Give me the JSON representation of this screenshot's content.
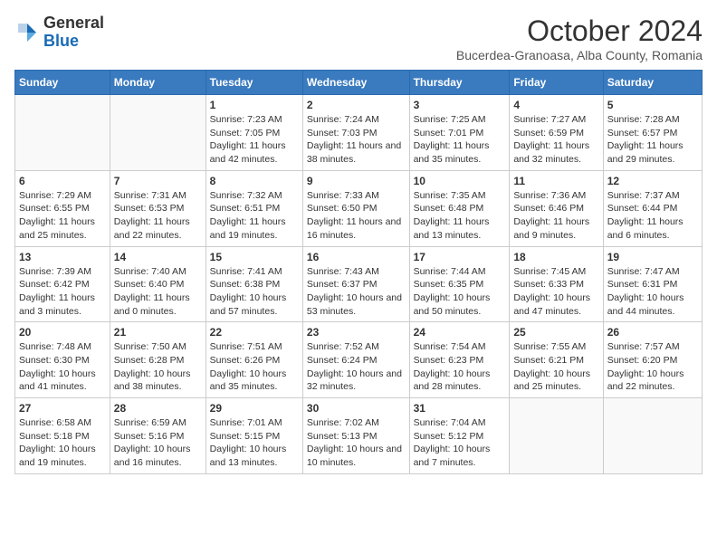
{
  "header": {
    "logo_general": "General",
    "logo_blue": "Blue",
    "month_title": "October 2024",
    "subtitle": "Bucerdea-Granoasa, Alba County, Romania"
  },
  "days_of_week": [
    "Sunday",
    "Monday",
    "Tuesday",
    "Wednesday",
    "Thursday",
    "Friday",
    "Saturday"
  ],
  "weeks": [
    [
      {
        "day": "",
        "info": ""
      },
      {
        "day": "",
        "info": ""
      },
      {
        "day": "1",
        "info": "Sunrise: 7:23 AM\nSunset: 7:05 PM\nDaylight: 11 hours and 42 minutes."
      },
      {
        "day": "2",
        "info": "Sunrise: 7:24 AM\nSunset: 7:03 PM\nDaylight: 11 hours and 38 minutes."
      },
      {
        "day": "3",
        "info": "Sunrise: 7:25 AM\nSunset: 7:01 PM\nDaylight: 11 hours and 35 minutes."
      },
      {
        "day": "4",
        "info": "Sunrise: 7:27 AM\nSunset: 6:59 PM\nDaylight: 11 hours and 32 minutes."
      },
      {
        "day": "5",
        "info": "Sunrise: 7:28 AM\nSunset: 6:57 PM\nDaylight: 11 hours and 29 minutes."
      }
    ],
    [
      {
        "day": "6",
        "info": "Sunrise: 7:29 AM\nSunset: 6:55 PM\nDaylight: 11 hours and 25 minutes."
      },
      {
        "day": "7",
        "info": "Sunrise: 7:31 AM\nSunset: 6:53 PM\nDaylight: 11 hours and 22 minutes."
      },
      {
        "day": "8",
        "info": "Sunrise: 7:32 AM\nSunset: 6:51 PM\nDaylight: 11 hours and 19 minutes."
      },
      {
        "day": "9",
        "info": "Sunrise: 7:33 AM\nSunset: 6:50 PM\nDaylight: 11 hours and 16 minutes."
      },
      {
        "day": "10",
        "info": "Sunrise: 7:35 AM\nSunset: 6:48 PM\nDaylight: 11 hours and 13 minutes."
      },
      {
        "day": "11",
        "info": "Sunrise: 7:36 AM\nSunset: 6:46 PM\nDaylight: 11 hours and 9 minutes."
      },
      {
        "day": "12",
        "info": "Sunrise: 7:37 AM\nSunset: 6:44 PM\nDaylight: 11 hours and 6 minutes."
      }
    ],
    [
      {
        "day": "13",
        "info": "Sunrise: 7:39 AM\nSunset: 6:42 PM\nDaylight: 11 hours and 3 minutes."
      },
      {
        "day": "14",
        "info": "Sunrise: 7:40 AM\nSunset: 6:40 PM\nDaylight: 11 hours and 0 minutes."
      },
      {
        "day": "15",
        "info": "Sunrise: 7:41 AM\nSunset: 6:38 PM\nDaylight: 10 hours and 57 minutes."
      },
      {
        "day": "16",
        "info": "Sunrise: 7:43 AM\nSunset: 6:37 PM\nDaylight: 10 hours and 53 minutes."
      },
      {
        "day": "17",
        "info": "Sunrise: 7:44 AM\nSunset: 6:35 PM\nDaylight: 10 hours and 50 minutes."
      },
      {
        "day": "18",
        "info": "Sunrise: 7:45 AM\nSunset: 6:33 PM\nDaylight: 10 hours and 47 minutes."
      },
      {
        "day": "19",
        "info": "Sunrise: 7:47 AM\nSunset: 6:31 PM\nDaylight: 10 hours and 44 minutes."
      }
    ],
    [
      {
        "day": "20",
        "info": "Sunrise: 7:48 AM\nSunset: 6:30 PM\nDaylight: 10 hours and 41 minutes."
      },
      {
        "day": "21",
        "info": "Sunrise: 7:50 AM\nSunset: 6:28 PM\nDaylight: 10 hours and 38 minutes."
      },
      {
        "day": "22",
        "info": "Sunrise: 7:51 AM\nSunset: 6:26 PM\nDaylight: 10 hours and 35 minutes."
      },
      {
        "day": "23",
        "info": "Sunrise: 7:52 AM\nSunset: 6:24 PM\nDaylight: 10 hours and 32 minutes."
      },
      {
        "day": "24",
        "info": "Sunrise: 7:54 AM\nSunset: 6:23 PM\nDaylight: 10 hours and 28 minutes."
      },
      {
        "day": "25",
        "info": "Sunrise: 7:55 AM\nSunset: 6:21 PM\nDaylight: 10 hours and 25 minutes."
      },
      {
        "day": "26",
        "info": "Sunrise: 7:57 AM\nSunset: 6:20 PM\nDaylight: 10 hours and 22 minutes."
      }
    ],
    [
      {
        "day": "27",
        "info": "Sunrise: 6:58 AM\nSunset: 5:18 PM\nDaylight: 10 hours and 19 minutes."
      },
      {
        "day": "28",
        "info": "Sunrise: 6:59 AM\nSunset: 5:16 PM\nDaylight: 10 hours and 16 minutes."
      },
      {
        "day": "29",
        "info": "Sunrise: 7:01 AM\nSunset: 5:15 PM\nDaylight: 10 hours and 13 minutes."
      },
      {
        "day": "30",
        "info": "Sunrise: 7:02 AM\nSunset: 5:13 PM\nDaylight: 10 hours and 10 minutes."
      },
      {
        "day": "31",
        "info": "Sunrise: 7:04 AM\nSunset: 5:12 PM\nDaylight: 10 hours and 7 minutes."
      },
      {
        "day": "",
        "info": ""
      },
      {
        "day": "",
        "info": ""
      }
    ]
  ]
}
